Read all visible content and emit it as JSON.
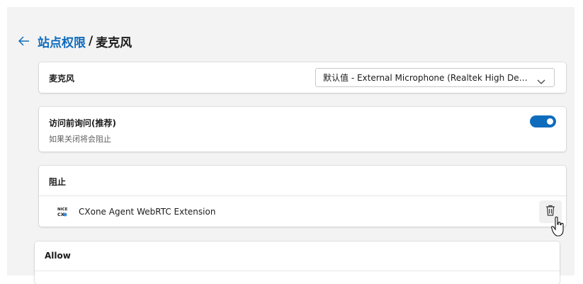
{
  "breadcrumb": {
    "back_icon": "arrow-left-icon",
    "parent": "站点权限",
    "separator": "/",
    "current": "麦克风"
  },
  "device": {
    "label": "麦克风",
    "selected": "默认值 - External Microphone (Realtek High Definition Audio)",
    "dropdown_icon": "chevron-down-icon"
  },
  "ask_before": {
    "label": "访问前询问(推荐)",
    "description": "如果关闭将会阻止",
    "enabled": true
  },
  "block": {
    "title": "阻止",
    "items": [
      {
        "name": "CXone Agent WebRTC Extension",
        "icon": "cxone-extension-icon",
        "icon_text": "NICE CX",
        "delete_icon": "trash-icon"
      }
    ]
  },
  "allow": {
    "title": "Allow"
  },
  "colors": {
    "accent": "#0f6cbd",
    "page_bg": "#f3f3f3",
    "card_bg": "#ffffff"
  }
}
